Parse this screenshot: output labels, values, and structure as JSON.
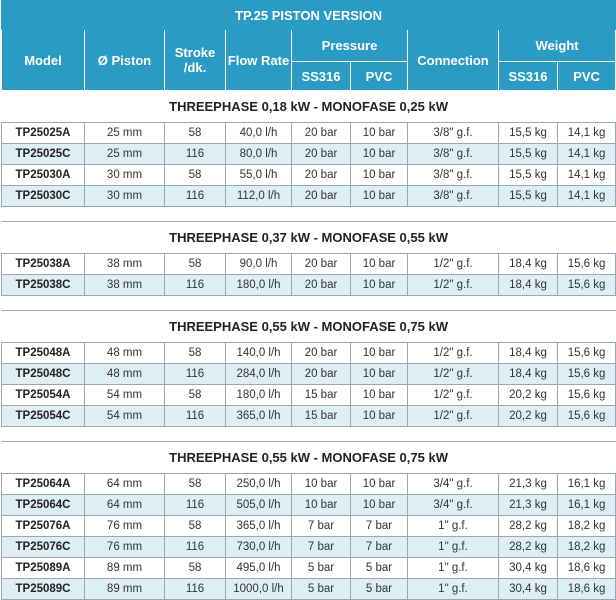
{
  "title": "TP.25 PISTON VERSION",
  "headers": {
    "model": "Model",
    "piston": "Ø Piston",
    "stroke": "Stroke /dk.",
    "flow": "Flow Rate",
    "pressure": "Pressure",
    "connection": "Connection",
    "weight": "Weight",
    "ss316": "SS316",
    "pvc": "PVC"
  },
  "sections": [
    {
      "heading": "THREEPHASE 0,18 kW - MONOFASE 0,25 kW",
      "rows": [
        [
          "TP25025A",
          "25 mm",
          "58",
          "40,0 l/h",
          "20 bar",
          "10 bar",
          "3/8\" g.f.",
          "15,5 kg",
          "14,1 kg"
        ],
        [
          "TP25025C",
          "25 mm",
          "116",
          "80,0 l/h",
          "20 bar",
          "10 bar",
          "3/8\" g.f.",
          "15,5 kg",
          "14,1 kg"
        ],
        [
          "TP25030A",
          "30 mm",
          "58",
          "55,0 l/h",
          "20 bar",
          "10 bar",
          "3/8\" g.f.",
          "15,5 kg",
          "14,1 kg"
        ],
        [
          "TP25030C",
          "30 mm",
          "116",
          "112,0 l/h",
          "20 bar",
          "10 bar",
          "3/8\" g.f.",
          "15,5 kg",
          "14,1 kg"
        ]
      ]
    },
    {
      "heading": "THREEPHASE 0,37 kW - MONOFASE 0,55 kW",
      "rows": [
        [
          "TP25038A",
          "38 mm",
          "58",
          "90,0 l/h",
          "20 bar",
          "10 bar",
          "1/2\" g.f.",
          "18,4 kg",
          "15,6 kg"
        ],
        [
          "TP25038C",
          "38 mm",
          "116",
          "180,0 l/h",
          "20 bar",
          "10 bar",
          "1/2\" g.f.",
          "18,4 kg",
          "15,6 kg"
        ]
      ]
    },
    {
      "heading": "THREEPHASE 0,55 kW - MONOFASE 0,75 kW",
      "rows": [
        [
          "TP25048A",
          "48 mm",
          "58",
          "140,0 l/h",
          "20 bar",
          "10 bar",
          "1/2\" g.f.",
          "18,4 kg",
          "15,6 kg"
        ],
        [
          "TP25048C",
          "48 mm",
          "116",
          "284,0 l/h",
          "20 bar",
          "10 bar",
          "1/2\" g.f.",
          "18,4 kg",
          "15,6 kg"
        ],
        [
          "TP25054A",
          "54 mm",
          "58",
          "180,0 l/h",
          "15 bar",
          "10 bar",
          "1/2\" g.f.",
          "20,2 kg",
          "15,6 kg"
        ],
        [
          "TP25054C",
          "54 mm",
          "116",
          "365,0 l/h",
          "15 bar",
          "10 bar",
          "1/2\" g.f.",
          "20,2 kg",
          "15,6 kg"
        ]
      ]
    },
    {
      "heading": "THREEPHASE 0,55 kW - MONOFASE 0,75 kW",
      "rows": [
        [
          "TP25064A",
          "64 mm",
          "58",
          "250,0 l/h",
          "10 bar",
          "10 bar",
          "3/4\" g.f.",
          "21,3 kg",
          "16,1 kg"
        ],
        [
          "TP25064C",
          "64 mm",
          "116",
          "505,0 l/h",
          "10 bar",
          "10 bar",
          "3/4\" g.f.",
          "21,3 kg",
          "16,1 kg"
        ],
        [
          "TP25076A",
          "76 mm",
          "58",
          "365,0 l/h",
          "7 bar",
          "7 bar",
          "1\" g.f.",
          "28,2 kg",
          "18,2 kg"
        ],
        [
          "TP25076C",
          "76 mm",
          "116",
          "730,0 l/h",
          "7 bar",
          "7 bar",
          "1\" g.f.",
          "28,2 kg",
          "18,2 kg"
        ],
        [
          "TP25089A",
          "89 mm",
          "58",
          "495,0 l/h",
          "5 bar",
          "5 bar",
          "1\" g.f.",
          "30,4 kg",
          "18,6 kg"
        ],
        [
          "TP25089C",
          "89 mm",
          "116",
          "1000,0 l/h",
          "5 bar",
          "5 bar",
          "1\" g.f.",
          "30,4 kg",
          "18,6 kg"
        ]
      ]
    }
  ]
}
